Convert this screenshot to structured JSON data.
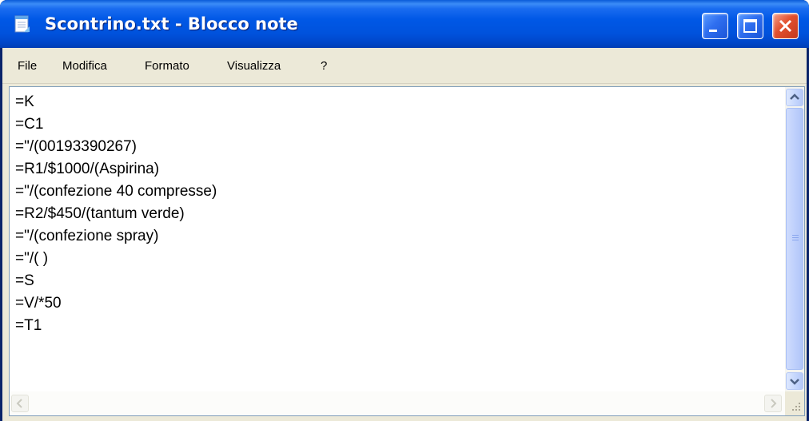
{
  "window": {
    "title": "Scontrino.txt - Blocco note",
    "icon": "notepad-icon",
    "controls": [
      "minimize-icon",
      "maximize-icon",
      "close-icon"
    ]
  },
  "menu": {
    "file": "File",
    "modifica": "Modifica",
    "formato": "Formato",
    "visualizza": "Visualizza",
    "help": "?"
  },
  "document": {
    "lines": [
      "=K",
      "=C1",
      "=\"/(00193390267)",
      "=R1/$1000/(Aspirina)",
      "=\"/(confezione 40 compresse)",
      "=R2/$450/(tantum verde)",
      "=\"/(confezione spray)",
      "=\"/( )",
      "=S",
      "=V/*50",
      "=T1"
    ]
  },
  "colors": {
    "title_bar": "#0058e6",
    "close_button": "#e2502e",
    "frame": "#ece9d8",
    "scrollbar": "#c3d5fd"
  }
}
